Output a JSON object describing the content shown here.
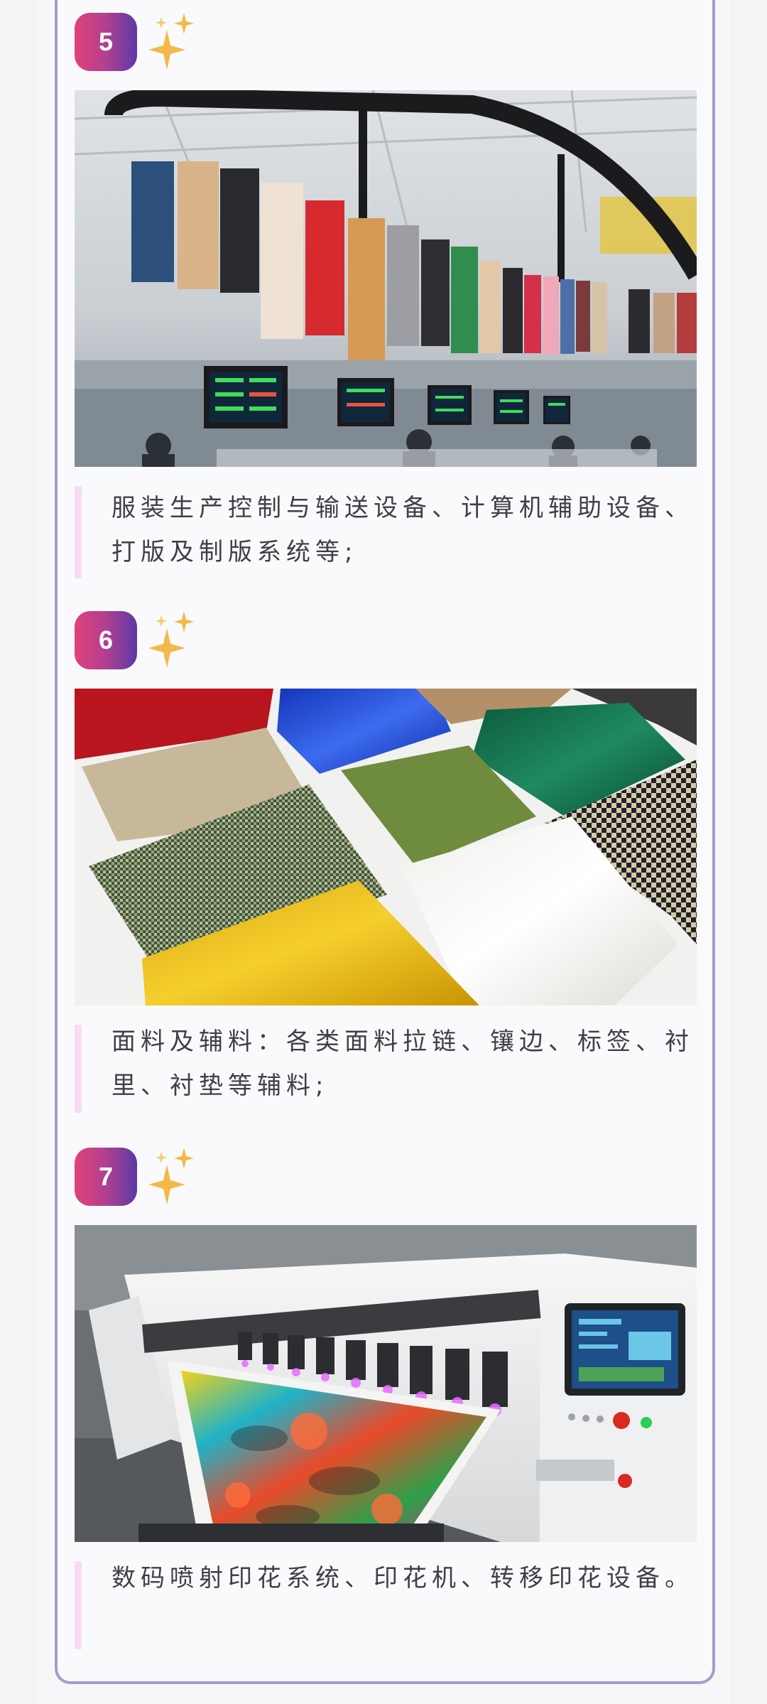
{
  "sections": [
    {
      "number": "5",
      "icon": "sparkles-icon",
      "image_alt": "服装生产线吊挂输送系统与工位电脑显示屏",
      "caption": "服装生产控制与输送设备、计算机辅助设备、打版及制版系统等;"
    },
    {
      "number": "6",
      "icon": "sparkles-icon",
      "image_alt": "各类面料样品平铺展示",
      "caption": "面料及辅料：各类面料拉链、镶边、标签、衬里、衬垫等辅料;"
    },
    {
      "number": "7",
      "icon": "sparkles-icon",
      "image_alt": "数码喷射印花机正在打印彩色花卉图案面料",
      "caption": "数码喷射印花系统、印花机、转移印花设备。"
    }
  ],
  "colors": {
    "badge_gradient_start": "#e0427a",
    "badge_gradient_end": "#5b3aa6",
    "card_border": "#a99bc9",
    "caption_bar": "#f6dcf5",
    "sparkle": "#f3b847",
    "caption_text": "#3f3f46"
  }
}
